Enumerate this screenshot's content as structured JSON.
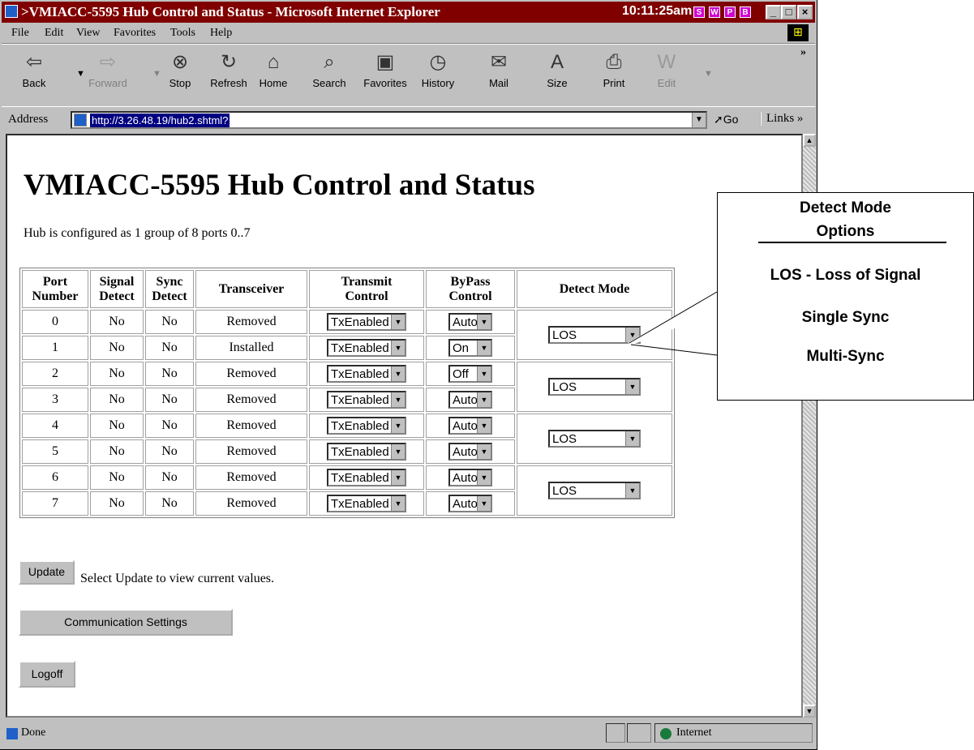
{
  "window": {
    "title": ">VMIACC-5595 Hub Control and Status - Microsoft Internet Explorer",
    "clock": "10:11:25am"
  },
  "menu": [
    "File",
    "Edit",
    "View",
    "Favorites",
    "Tools",
    "Help"
  ],
  "toolbar": [
    {
      "label": "Back",
      "icon": "back-arrow-icon"
    },
    {
      "label": "Forward",
      "icon": "forward-arrow-icon"
    },
    {
      "label": "Stop",
      "icon": "stop-icon"
    },
    {
      "label": "Refresh",
      "icon": "refresh-icon"
    },
    {
      "label": "Home",
      "icon": "home-icon"
    },
    {
      "label": "Search",
      "icon": "search-icon"
    },
    {
      "label": "Favorites",
      "icon": "favorites-icon"
    },
    {
      "label": "History",
      "icon": "history-icon"
    },
    {
      "label": "Mail",
      "icon": "mail-icon"
    },
    {
      "label": "Size",
      "icon": "size-icon"
    },
    {
      "label": "Print",
      "icon": "print-icon"
    },
    {
      "label": "Edit",
      "icon": "edit-icon"
    }
  ],
  "address": {
    "label": "Address",
    "url": "http://3.26.48.19/hub2.shtml?",
    "go": "Go",
    "links": "Links"
  },
  "page": {
    "title": "VMIACC-5595 Hub Control and Status",
    "config_text": "Hub is configured as 1 group of 8 ports 0..7",
    "headers": {
      "port": [
        "Port",
        "Number"
      ],
      "signal": [
        "Signal",
        "Detect"
      ],
      "sync": [
        "Sync",
        "Detect"
      ],
      "transceiver": "Transceiver",
      "transmit": [
        "Transmit",
        "Control"
      ],
      "bypass": [
        "ByPass",
        "Control"
      ],
      "detect": "Detect Mode"
    },
    "rows": [
      {
        "port": "0",
        "signal": "No",
        "sync": "No",
        "transceiver": "Removed",
        "transmit": "TxEnabled",
        "bypass": "Auto"
      },
      {
        "port": "1",
        "signal": "No",
        "sync": "No",
        "transceiver": "Installed",
        "transmit": "TxEnabled",
        "bypass": "On"
      },
      {
        "port": "2",
        "signal": "No",
        "sync": "No",
        "transceiver": "Removed",
        "transmit": "TxEnabled",
        "bypass": "Off"
      },
      {
        "port": "3",
        "signal": "No",
        "sync": "No",
        "transceiver": "Removed",
        "transmit": "TxEnabled",
        "bypass": "Auto"
      },
      {
        "port": "4",
        "signal": "No",
        "sync": "No",
        "transceiver": "Removed",
        "transmit": "TxEnabled",
        "bypass": "Auto"
      },
      {
        "port": "5",
        "signal": "No",
        "sync": "No",
        "transceiver": "Removed",
        "transmit": "TxEnabled",
        "bypass": "Auto"
      },
      {
        "port": "6",
        "signal": "No",
        "sync": "No",
        "transceiver": "Removed",
        "transmit": "TxEnabled",
        "bypass": "Auto"
      },
      {
        "port": "7",
        "signal": "No",
        "sync": "No",
        "transceiver": "Removed",
        "transmit": "TxEnabled",
        "bypass": "Auto"
      }
    ],
    "detect_modes": [
      "LOS",
      "LOS",
      "LOS",
      "LOS"
    ],
    "update_button": "Update",
    "update_hint": "Select Update to view current values.",
    "comm_button": "Communication Settings",
    "logoff_button": "Logoff"
  },
  "status": {
    "text": "Done",
    "zone": "Internet"
  },
  "callout": {
    "title_line1": "Detect Mode",
    "title_line2": "Options",
    "options": [
      "LOS - Loss of Signal",
      "Single Sync",
      "Multi-Sync"
    ]
  }
}
